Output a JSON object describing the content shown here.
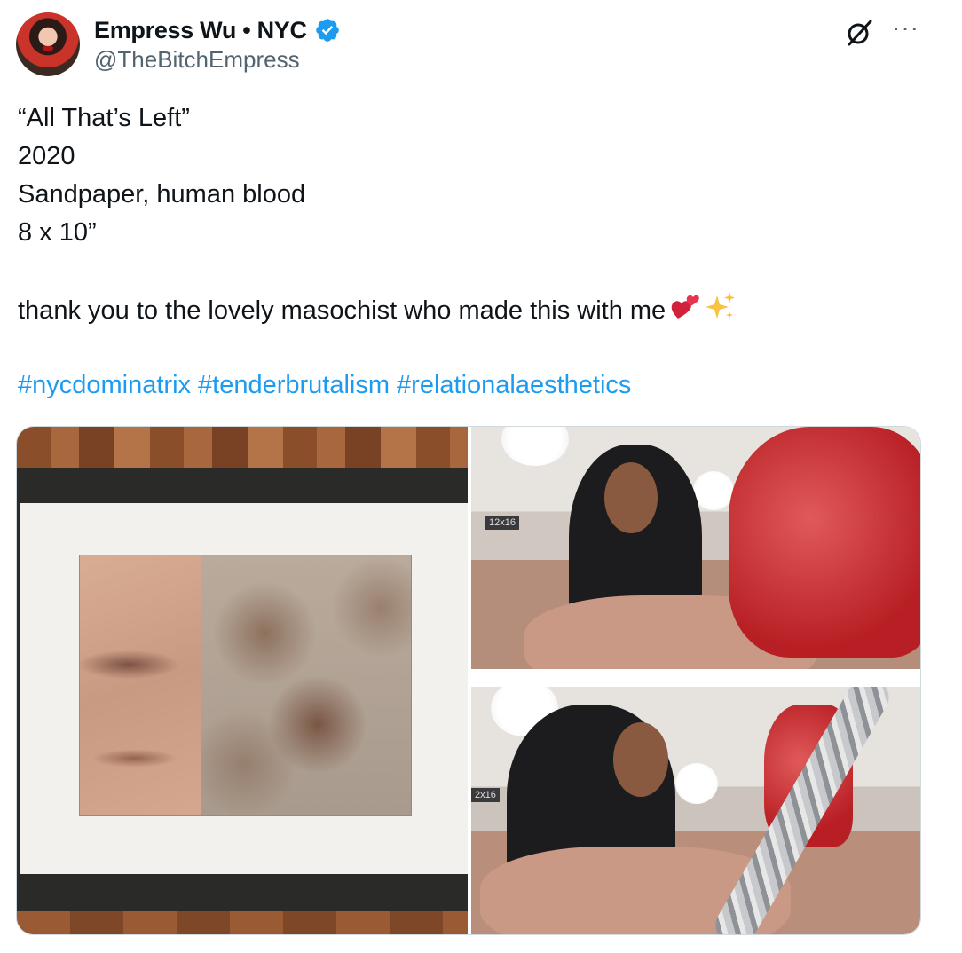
{
  "author": {
    "display_name": "Empress Wu • NYC",
    "handle": "@TheBitchEmpress",
    "verified": true,
    "avatar_icon": "avatar-photo"
  },
  "actions": {
    "grok_icon": "grok-icon",
    "more_icon": "more-options-icon",
    "more_label": "···"
  },
  "post": {
    "lines": [
      "“All That’s Left”",
      "2020",
      "Sandpaper, human blood",
      "8 x 10”"
    ],
    "thanks": "thank you to the lovely masochist who made this with me",
    "emojis": [
      "💕",
      "✨"
    ],
    "hashtags": [
      "#nycdominatrix",
      "#tenderbrutalism",
      "#relationalaesthetics"
    ]
  },
  "media": {
    "count": 3,
    "sign_text_top": "12x16",
    "sign_text_bottom": "2x16"
  },
  "colors": {
    "text": "#0f1419",
    "secondary": "#536471",
    "link": "#1d9bf0",
    "verified": "#1d9bf0"
  }
}
